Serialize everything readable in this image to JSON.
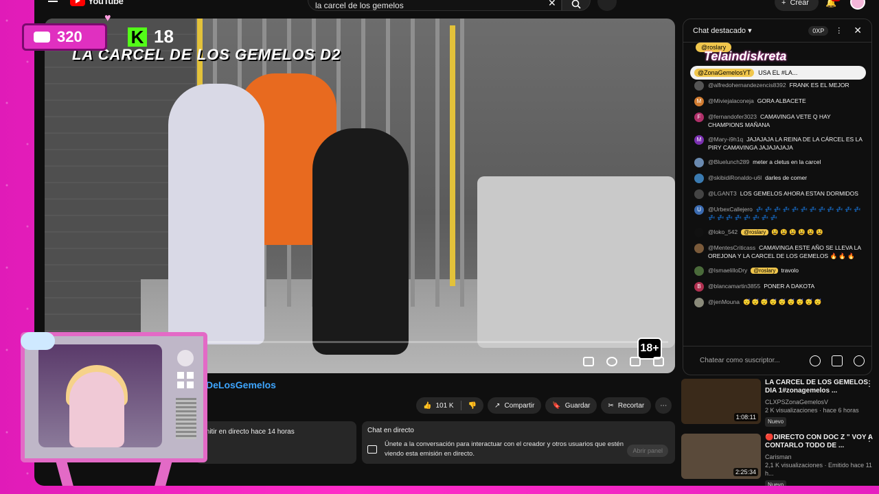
{
  "header": {
    "logo_text": "YouTube",
    "search_value": "la carcel de los gemelos",
    "create_label": "Crear"
  },
  "video": {
    "overlay_title": "LA CARCEL DE LOS GEMELOS D2",
    "rating": "18+",
    "overlay_counters": {
      "viewers": "320",
      "kick_viewers": "18"
    }
  },
  "below_video": {
    "channel_name": "DeLosGemelos",
    "likes": "101 K",
    "share_label": "Compartir",
    "save_label": "Guardar",
    "clip_label": "Recortar",
    "desc_text": "mitir en directo hace 14 horas",
    "chat_info_title": "Chat en directo",
    "chat_info_text": "Únete a la conversación para interactuar con el creador y otros usuarios que estén viendo esta emisión en directo.",
    "open_panel_label": "Abrir panel"
  },
  "chat": {
    "title": "Chat destacado",
    "xp": "0XP",
    "pinned_user": "@roslary",
    "brand_logo": "Telaindiskreta",
    "pinned_author": "@ZonaGemelosYT",
    "pinned_text": "USA EL #LA...",
    "messages": [
      {
        "author": "@alfredohernandezencis8392",
        "text": "FRANK ES EL MEJOR",
        "avatar": "",
        "color": "#555"
      },
      {
        "author": "@Miviejalaconeja",
        "text": "GORA ALBACETE",
        "avatar": "M",
        "color": "#d07a2f"
      },
      {
        "author": "@fernandofer3023",
        "text": "CAMAVINGA VETE Q HAY CHAMPIONS MAÑANA",
        "avatar": "F",
        "color": "#b0306a"
      },
      {
        "author": "@Mary-i9h1q",
        "text": "JAJAJAJA LA REINA DE LA CÁRCEL ES LA PIRY CAMAVINGA JAJAJAJAJA",
        "avatar": "M",
        "color": "#7a2fb0"
      },
      {
        "author": "@Bluelunch289",
        "text": "meter a cletus en la carcel",
        "avatar": "",
        "color": "#6a8ab0"
      },
      {
        "author": "@skibidiRonaldo-u6l",
        "text": "darles de comer",
        "avatar": "",
        "color": "#3a7ab0"
      },
      {
        "author": "@LGANT3",
        "text": "LOS GEMELOS AHORA ESTAN DORMIDOS",
        "avatar": "",
        "color": "#444"
      },
      {
        "author": "@UrbexCallejero",
        "text": "💤 💤 💤 💤 💤 💤 💤 💤 💤 💤 💤 💤 💤 💤 💤 💤 💤 💤 💤 💤",
        "avatar": "U",
        "color": "#3a6ab0"
      },
      {
        "author": "@loko_542",
        "badge": "@roslary",
        "text": "😫 😫 😫 😫 😫 😫",
        "avatar": "",
        "color": "#111"
      },
      {
        "author": "@MentesCriticass",
        "text": "CAMAVINGA ESTE AÑO SE LLEVA LA OREJONA Y LA CARCEL DE LOS GEMELOS 🔥 🔥 🔥",
        "avatar": "",
        "color": "#7a5a3a"
      },
      {
        "author": "@IsmaelilloDry",
        "badge": "@roslary",
        "text": "travolo",
        "avatar": "",
        "color": "#4a6a3a"
      },
      {
        "author": "@blancamartin3855",
        "text": "PONER A DAKOTA",
        "avatar": "B",
        "color": "#b03050"
      },
      {
        "author": "@jenMouna",
        "text": "😴 😴 😴 😴 😴 😴 😴 😴 😴",
        "avatar": "",
        "color": "#8a8a7a"
      }
    ],
    "input_placeholder": "Chatear como suscriptor..."
  },
  "recommendations": [
    {
      "title": "LA CARCEL DE LOS GEMELOS DIA 1#zonagemelos ...",
      "channel": "CLXPSZonaGemelosV",
      "meta": "2 K visualizaciones · hace 6 horas",
      "duration": "1:08:11",
      "badge": "Nuevo",
      "thumb_color": "#3a2a1a"
    },
    {
      "title": "🔴DIRECTO CON DOC Z \" VOY A CONTARLO TODO DE ...",
      "channel": "Carisman",
      "meta": "2,1 K visualizaciones · Emitido hace 11 h...",
      "duration": "2:25:34",
      "badge": "Nuevo",
      "thumb_color": "#5a4a3a"
    }
  ],
  "colors": {
    "accent_pink": "#e01bb8",
    "youtube_red": "#ff0000",
    "kick_green": "#53fc18",
    "mod_yellow": "#f0c64c"
  }
}
